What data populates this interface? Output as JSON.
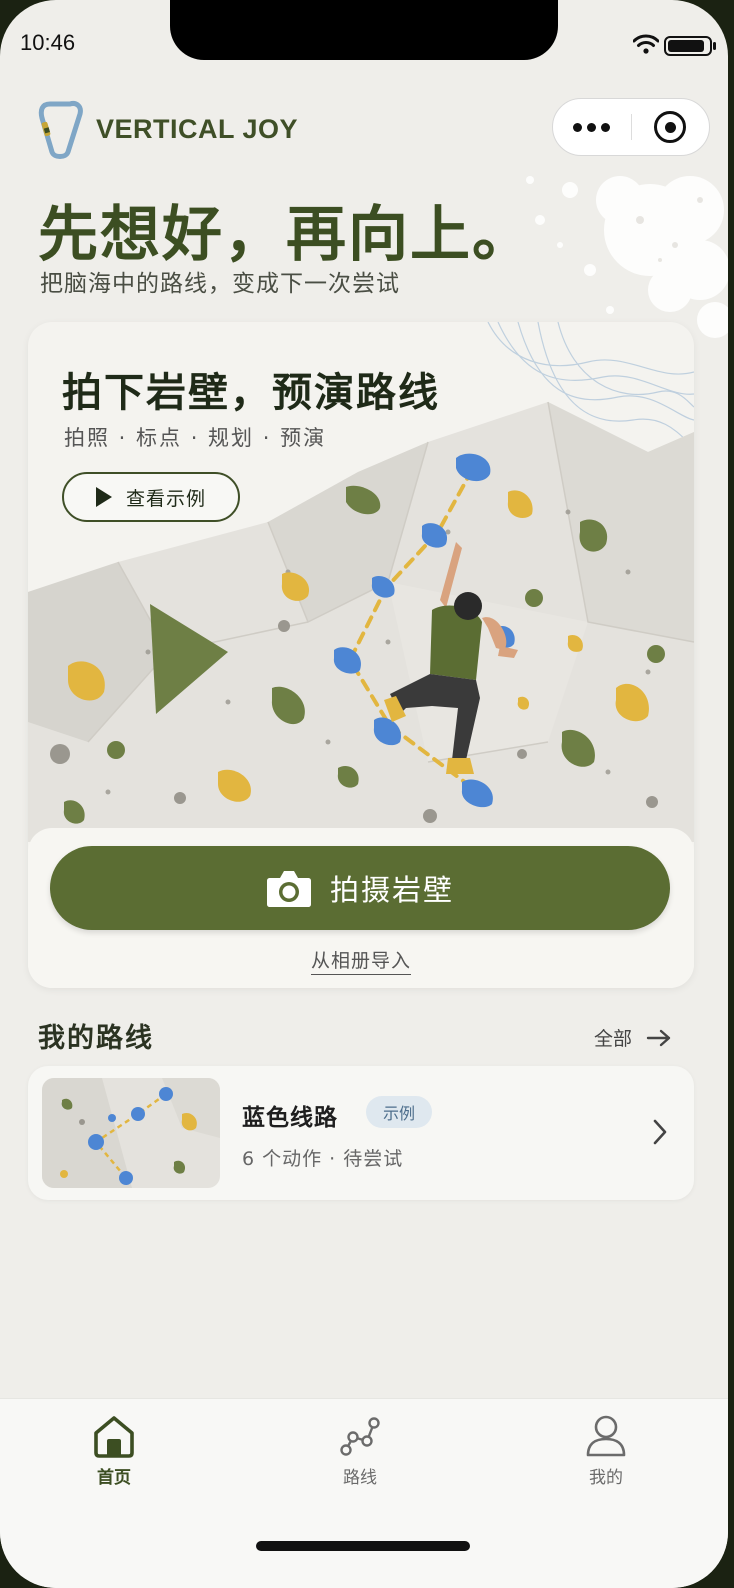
{
  "status_bar": {
    "time": "10:46",
    "battery_level": 0.9
  },
  "brand": {
    "name": "VERTICAL JOY"
  },
  "hero": {
    "headline": "先想好，再向上。",
    "subline": "把脑海中的路线，变成下一次尝试"
  },
  "feature_card": {
    "title": "拍下岩壁，预演路线",
    "steps": "拍照 · 标点 · 规划 · 预演",
    "example_button": "查看示例",
    "shoot_button": "拍摄岩壁",
    "import_link": "从相册导入"
  },
  "my_routes": {
    "title": "我的路线",
    "view_all": "全部",
    "items": [
      {
        "name": "蓝色线路",
        "tag": "示例",
        "meta": "6 个动作 · 待尝试"
      }
    ]
  },
  "tab_bar": {
    "tabs": [
      {
        "label": "首页",
        "icon": "home-icon",
        "active": true
      },
      {
        "label": "路线",
        "icon": "route-icon",
        "active": false
      },
      {
        "label": "我的",
        "icon": "user-icon",
        "active": false
      }
    ]
  },
  "colors": {
    "brand_green": "#3c4e22",
    "button_green": "#5b6d33",
    "hold_blue": "#4d86d4",
    "hold_yellow": "#e2b640",
    "hold_green": "#6e7f45"
  }
}
